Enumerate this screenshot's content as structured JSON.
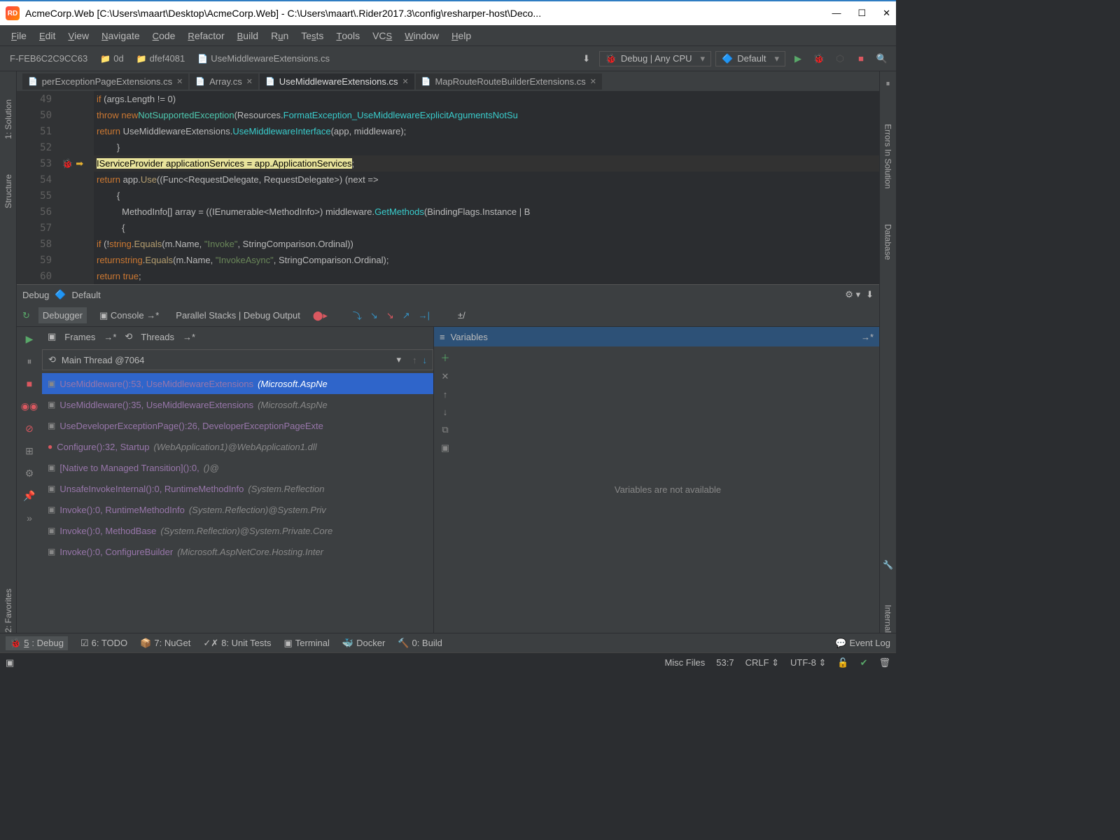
{
  "window": {
    "title": "AcmeCorp.Web [C:\\Users\\maart\\Desktop\\AcmeCorp.Web] - C:\\Users\\maart\\.Rider2017.3\\config\\resharper-host\\Deco..."
  },
  "menu": [
    "File",
    "Edit",
    "View",
    "Navigate",
    "Code",
    "Refactor",
    "Build",
    "Run",
    "Tests",
    "Tools",
    "VCS",
    "Window",
    "Help"
  ],
  "breadcrumb": {
    "p1": "F-FEB6C2C9CC63",
    "p2": "0d",
    "p3": "dfef4081",
    "p4": "UseMiddlewareExtensions.cs"
  },
  "runconf": {
    "debug": "Debug | Any CPU",
    "default": "Default"
  },
  "tabs": [
    {
      "label": "perExceptionPageExtensions.cs",
      "active": false
    },
    {
      "label": "Array.cs",
      "active": false
    },
    {
      "label": "UseMiddlewareExtensions.cs",
      "active": true
    },
    {
      "label": "MapRouteRouteBuilderExtensions.cs",
      "active": false
    }
  ],
  "leftRail": [
    "1: Solution",
    "Structure"
  ],
  "rightRail": [
    "Errors In Solution",
    "Database",
    "Internal"
  ],
  "favLabel": "2: Favorites",
  "gutter": [
    "49",
    "50",
    "51",
    "52",
    "53",
    "54",
    "55",
    "56",
    "57",
    "58",
    "59",
    "60"
  ],
  "debug": {
    "title": "Debug",
    "conf": "Default",
    "tabs": {
      "debugger": "Debugger",
      "console": "Console",
      "pstacks": "Parallel Stacks | Debug Output"
    },
    "framesHdr": "Frames",
    "threadsHdr": "Threads",
    "thread": "Main Thread @7064",
    "varsHdr": "Variables",
    "varsEmpty": "Variables are not available",
    "frames": [
      {
        "a": "UseMiddleware():53, UseMiddlewareExtensions",
        "b": "(Microsoft.AspNe",
        "sel": true
      },
      {
        "a": "UseMiddleware():35, UseMiddlewareExtensions",
        "b": "(Microsoft.AspNe",
        "sel": false
      },
      {
        "a": "UseDeveloperExceptionPage():26, DeveloperExceptionPageExte",
        "b": "",
        "sel": false
      },
      {
        "a": "Configure():32, Startup",
        "b": "(WebApplication1)@WebApplication1.dll",
        "sel": false,
        "red": true
      },
      {
        "a": "[Native to Managed Transition]():0,",
        "b": "()@",
        "sel": false
      },
      {
        "a": "UnsafeInvokeInternal():0, RuntimeMethodInfo",
        "b": "(System.Reflection",
        "sel": false
      },
      {
        "a": "Invoke():0, RuntimeMethodInfo",
        "b": "(System.Reflection)@System.Priv",
        "sel": false
      },
      {
        "a": "Invoke():0, MethodBase",
        "b": "(System.Reflection)@System.Private.Core",
        "sel": false
      },
      {
        "a": "Invoke():0, ConfigureBuilder",
        "b": "(Microsoft.AspNetCore.Hosting.Inter",
        "sel": false
      }
    ]
  },
  "bottomBar": {
    "debug": "5: Debug",
    "todo": "6: TODO",
    "nuget": "7: NuGet",
    "unit": "8: Unit Tests",
    "terminal": "Terminal",
    "docker": "Docker",
    "build": "0: Build",
    "eventlog": "Event Log"
  },
  "status": {
    "misc": "Misc Files",
    "pos": "53:7",
    "crlf": "CRLF",
    "enc": "UTF-8"
  }
}
